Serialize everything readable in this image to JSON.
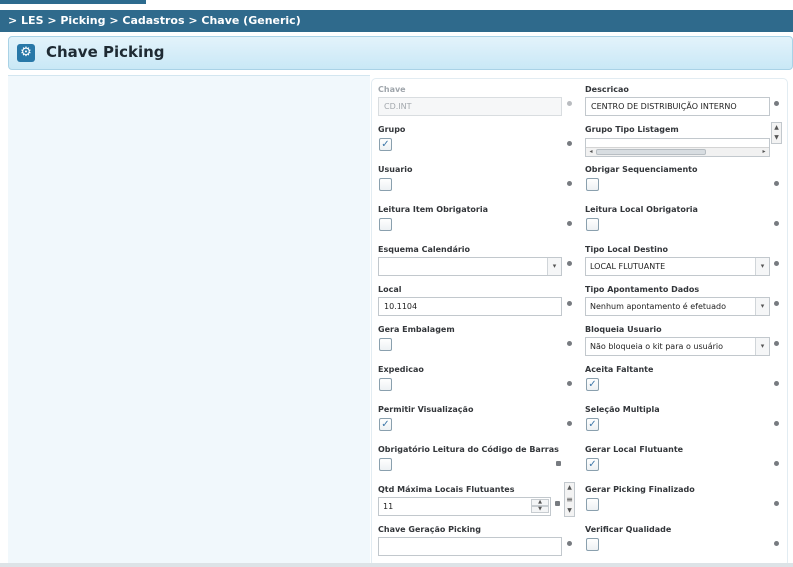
{
  "breadcrumb": "> LES > Picking > Cadastros > Chave (Generic)",
  "page_title": "Chave Picking",
  "title_icon": "gear-icon",
  "fields": {
    "chave": {
      "label": "Chave",
      "value": "CD.INT",
      "disabled": true
    },
    "descricao": {
      "label": "Descricao",
      "value": "CENTRO DE DISTRIBUIÇÃO INTERNO"
    },
    "grupo": {
      "label": "Grupo",
      "checked": true
    },
    "grupo_tipo_listagem": {
      "label": "Grupo Tipo Listagem"
    },
    "usuario": {
      "label": "Usuario",
      "checked": false
    },
    "obrigar_sequenciamento": {
      "label": "Obrigar Sequenciamento",
      "checked": false
    },
    "leitura_item_obrigatoria": {
      "label": "Leitura Item Obrigatoria",
      "checked": false
    },
    "leitura_local_obrigatoria": {
      "label": "Leitura Local Obrigatoria",
      "checked": false
    },
    "esquema_calendario": {
      "label": "Esquema Calendário",
      "value": ""
    },
    "tipo_local_destino": {
      "label": "Tipo Local Destino",
      "value": "LOCAL FLUTUANTE"
    },
    "local": {
      "label": "Local",
      "value": "10.1104"
    },
    "tipo_apontamento_dados": {
      "label": "Tipo Apontamento Dados",
      "value": "Nenhum apontamento é efetuado"
    },
    "gera_embalagem": {
      "label": "Gera Embalagem",
      "checked": false
    },
    "bloqueia_usuario": {
      "label": "Bloqueia Usuario",
      "value": "Não bloqueia o kit para o usuário"
    },
    "expedicao": {
      "label": "Expedicao",
      "checked": false
    },
    "aceita_faltante": {
      "label": "Aceita Faltante",
      "checked": true
    },
    "permitir_visualizacao": {
      "label": "Permitir Visualização",
      "checked": true
    },
    "selecao_multipla": {
      "label": "Seleção Multipla",
      "checked": true
    },
    "obrigatorio_leitura_codigo_barras": {
      "label": "Obrigatório Leitura do Código de Barras",
      "checked": false
    },
    "gerar_local_flutuante": {
      "label": "Gerar Local Flutuante",
      "checked": true
    },
    "qtd_maxima_locais_flutuantes": {
      "label": "Qtd Máxima Locais Flutuantes",
      "value": "11"
    },
    "gerar_picking_finalizado": {
      "label": "Gerar Picking Finalizado",
      "checked": false
    },
    "chave_geracao_picking": {
      "label": "Chave Geração Picking",
      "value": ""
    },
    "verificar_qualidade": {
      "label": "Verificar Qualidade",
      "checked": false
    }
  },
  "check_mark": "✓",
  "icons": {
    "dropdown": "▾",
    "up": "▲",
    "down": "▼",
    "left": "◂",
    "right": "▸",
    "grip": "≡",
    "gear": "⚙"
  }
}
